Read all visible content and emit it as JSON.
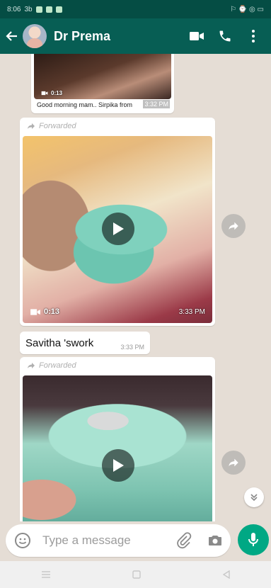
{
  "status_bar": {
    "time": "8:06",
    "left_extra": "3b",
    "right_icons": "⚐ ⌚ ◎ ▭"
  },
  "header": {
    "contact_name": "Dr Prema"
  },
  "messages": {
    "m1": {
      "caption": "Good morning mam.. Sirpika from",
      "duration": "0:13",
      "time": "3:32 PM"
    },
    "m2": {
      "forwarded_label": "Forwarded",
      "duration": "0:13",
      "time": "3:33 PM"
    },
    "m3": {
      "text": "Savitha 'swork",
      "time": "3:33 PM"
    },
    "m4": {
      "forwarded_label": "Forwarded"
    }
  },
  "composer": {
    "placeholder": "Type a message"
  },
  "colors": {
    "header": "#075e54",
    "status_bar": "#054d44",
    "chat_bg": "#e5ddd5",
    "mic": "#00a884"
  }
}
